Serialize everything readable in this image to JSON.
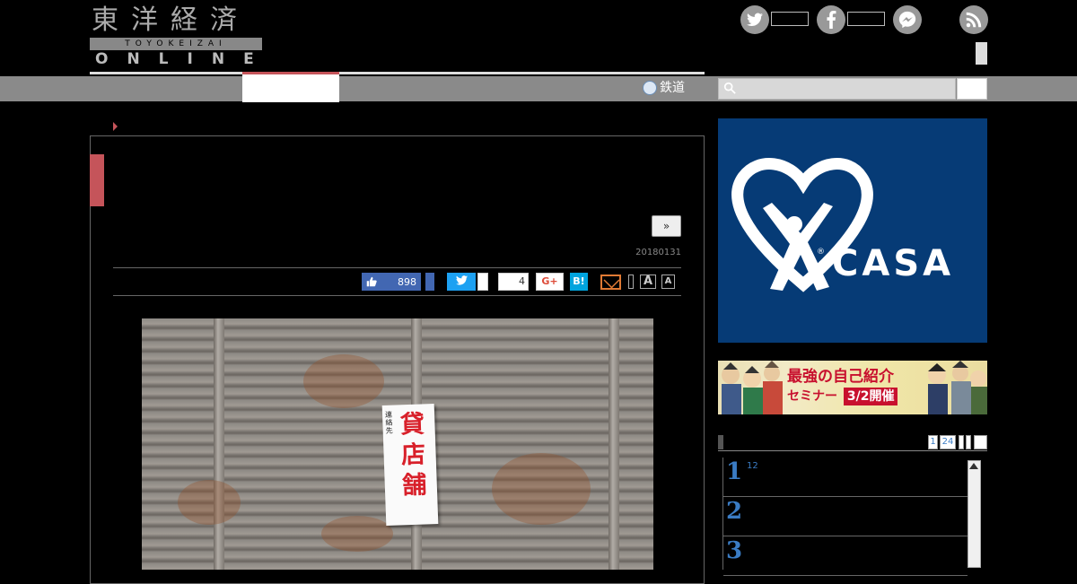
{
  "header": {
    "logo_kanji": "東洋経済",
    "logo_roman": "TOYOKEIZAI",
    "logo_online": "ONLINE",
    "social_icons": [
      "twitter-icon",
      "facebook-icon",
      "messenger-icon",
      "rss-icon"
    ]
  },
  "nav": {
    "rail_label": "鉄道",
    "search_icon": "🔍"
  },
  "article": {
    "next_label": "»",
    "date": "20180131",
    "share": {
      "like_count": "898",
      "pocket_count": "4",
      "gplus_label": "G+",
      "hatena_label": "B!",
      "font_large": "A",
      "font_small": "A"
    },
    "photo_sign": {
      "small_text": "連絡先",
      "big_text": "貸店舗"
    }
  },
  "sidebar": {
    "casa_ad": {
      "brand": "CASA",
      "registered": "®"
    },
    "seminar_ad": {
      "title": "最強の自己紹介",
      "subtitle": "セミナー",
      "date": "3/2開催"
    },
    "ranking": {
      "tabs": [
        "1",
        "24"
      ],
      "items": [
        {
          "num": "1",
          "text": "12"
        },
        {
          "num": "2",
          "text": ""
        },
        {
          "num": "3",
          "text": ""
        }
      ]
    }
  },
  "colors": {
    "accent": "#c5545a",
    "nav_gray": "#8a8a8a",
    "facebook": "#4267b2",
    "twitter": "#1da1f2",
    "hatena": "#00a4de",
    "casa_blue": "#063b76",
    "rank_blue": "#3a7cc4"
  }
}
